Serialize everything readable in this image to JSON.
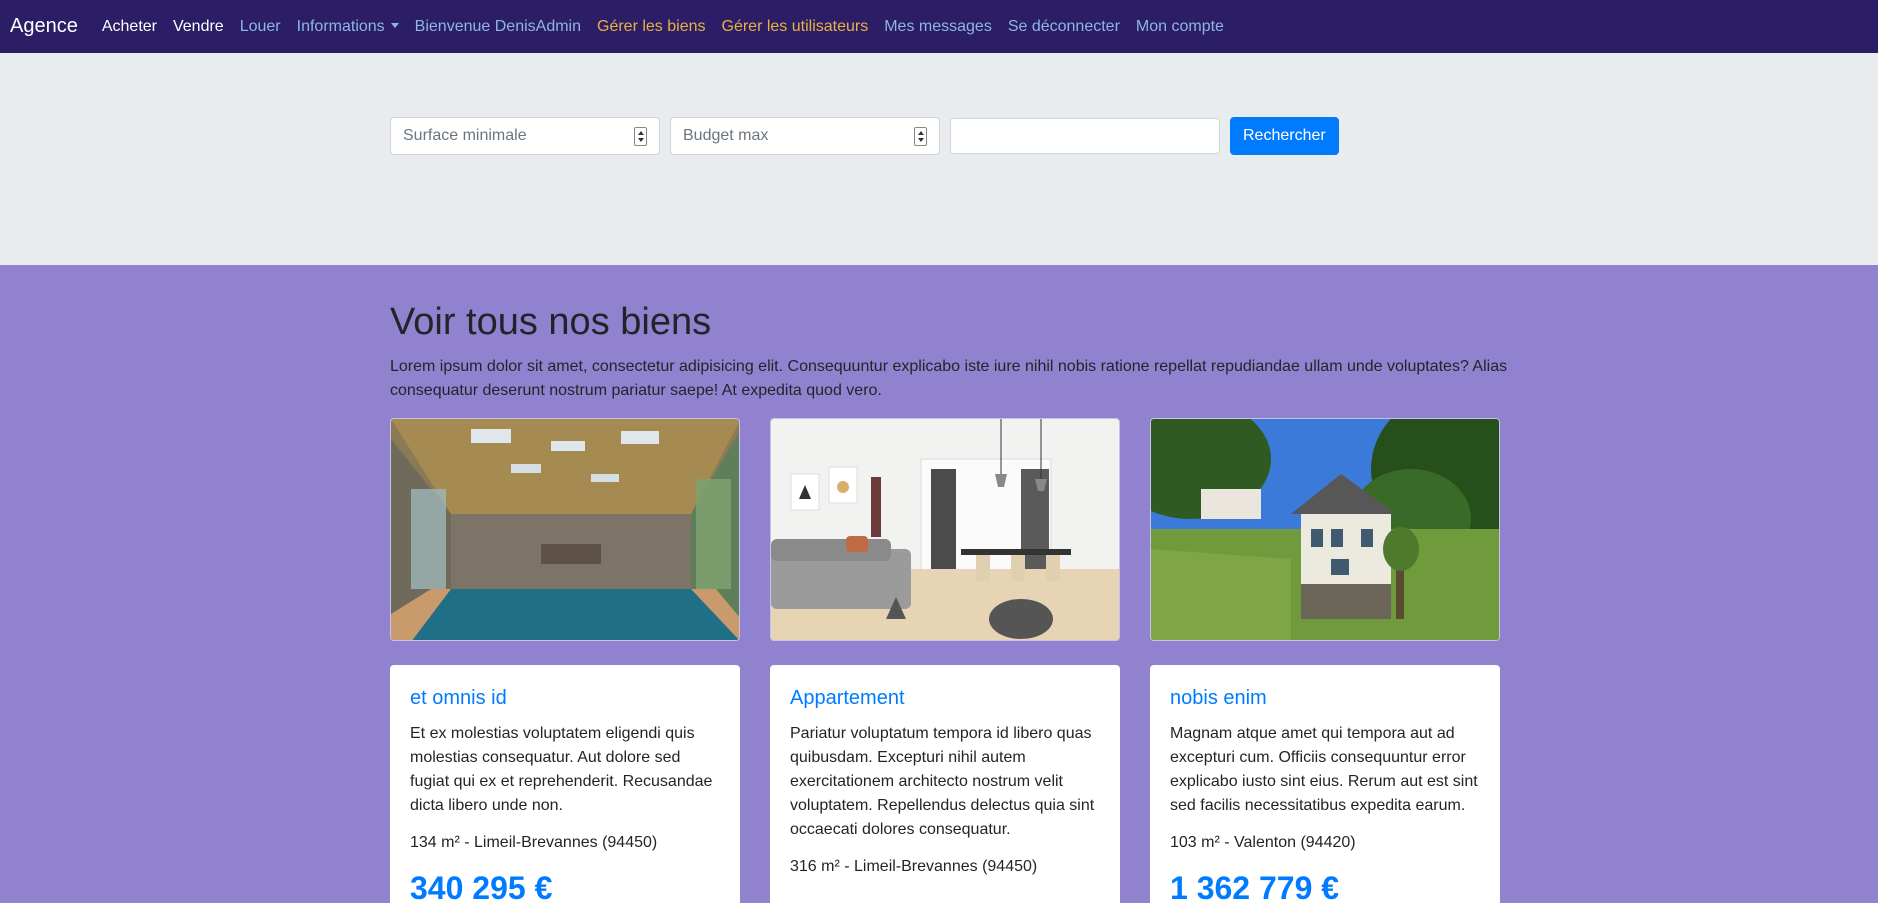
{
  "nav": {
    "brand": "Agence",
    "links": [
      {
        "label": "Acheter"
      },
      {
        "label": "Vendre"
      },
      {
        "label": "Louer"
      },
      {
        "label": "Informations"
      },
      {
        "label": "Bienvenue DenisAdmin"
      },
      {
        "label": "Gérer les biens"
      },
      {
        "label": "Gérer les utilisateurs"
      },
      {
        "label": "Mes messages"
      },
      {
        "label": "Se déconnecter"
      },
      {
        "label": "Mon compte"
      }
    ]
  },
  "search": {
    "surface_placeholder": "Surface minimale",
    "budget_placeholder": "Budget max",
    "keyword_value": "",
    "submit_label": "Rechercher"
  },
  "listings": {
    "title": "Voir tous nos biens",
    "description": "Lorem ipsum dolor sit amet, consectetur adipisicing elit. Consequuntur explicabo iste iure nihil nobis ratione repellat repudiandae ullam unde voluptates? Alias consequatur deserunt nostrum pariatur saepe! At expedita quod vero.",
    "cards": [
      {
        "title": "et omnis id",
        "text": "Et ex molestias voluptatem eligendi quis molestias consequatur. Aut dolore sed fugiat qui ex et reprehenderit. Recusandae dicta libero unde non.",
        "meta": "134 m² - Limeil-Brevannes (94450)",
        "price": "340 295 €"
      },
      {
        "title": "Appartement",
        "text": "Pariatur voluptatum tempora id libero quas quibusdam. Excepturi nihil autem exercitationem architecto nostrum velit voluptatem. Repellendus delectus quia sint occaecati dolores consequatur.",
        "meta": "316 m² - Limeil-Brevannes (94450)",
        "price": ""
      },
      {
        "title": "nobis enim",
        "text": "Magnam atque amet qui tempora aut ad excepturi cum. Officiis consequuntur error explicabo iusto sint eius. Rerum aut est sint sed facilis necessitatibus expedita earum.",
        "meta": "103 m² - Valenton (94420)",
        "price": "1 362 779 €"
      }
    ]
  }
}
